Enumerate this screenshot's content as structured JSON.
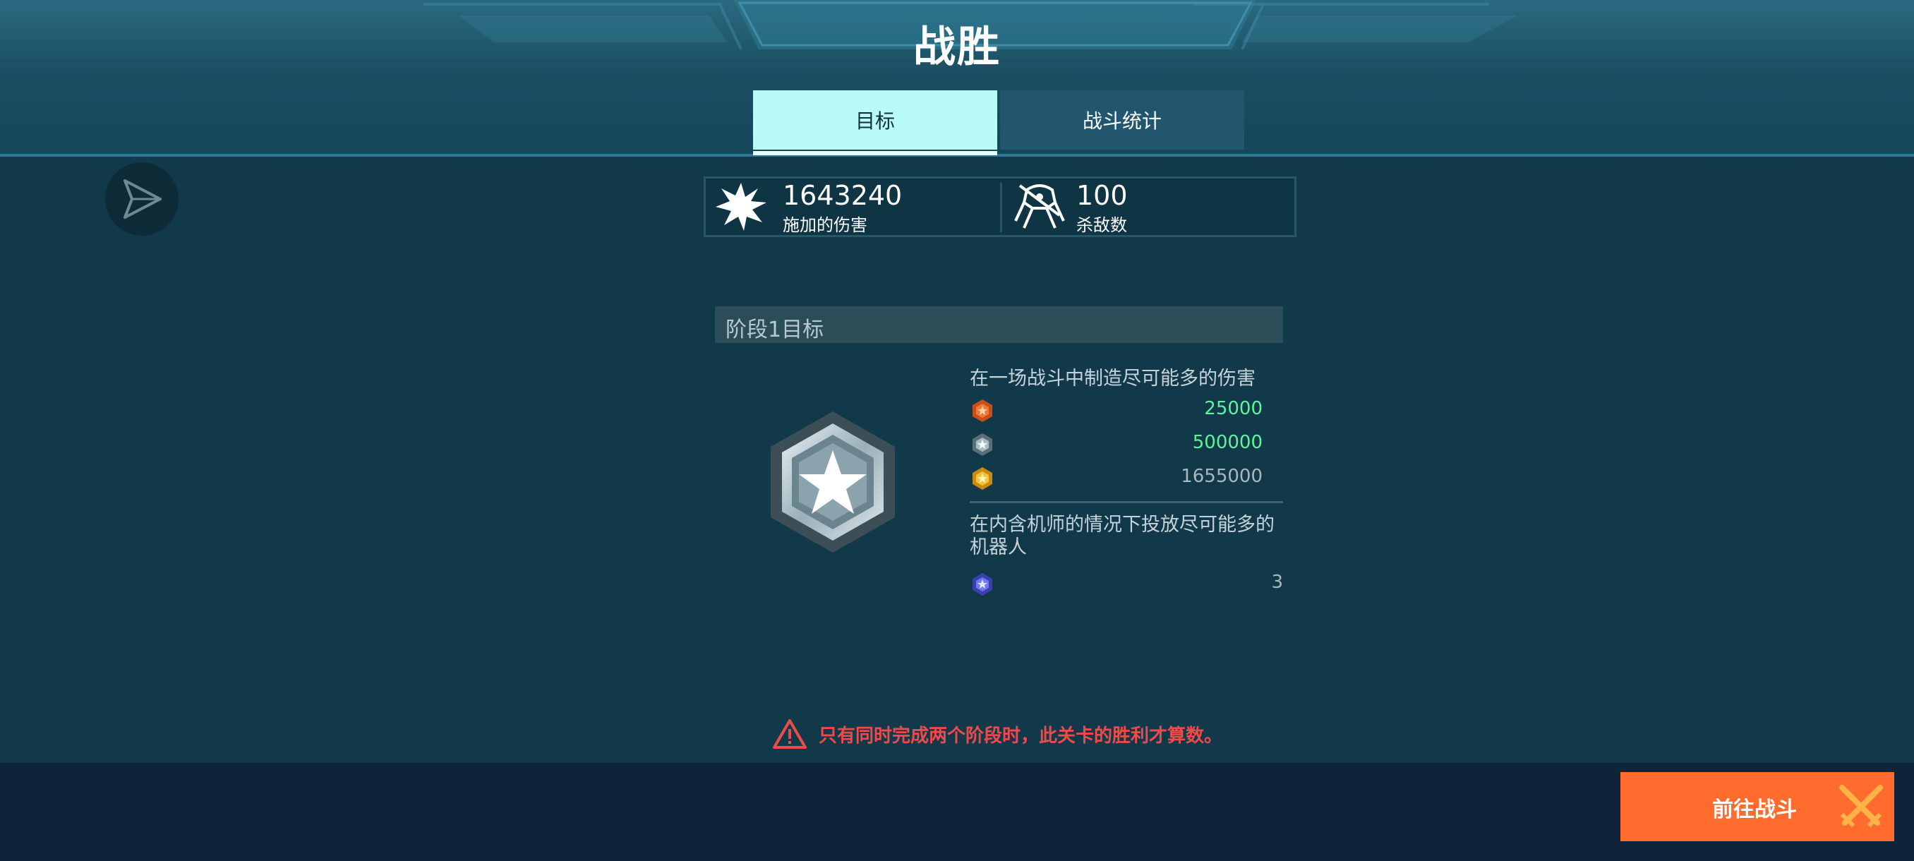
{
  "header": {
    "title": "战胜",
    "tabs": [
      {
        "label": "目标",
        "active": true
      },
      {
        "label": "战斗统计",
        "active": false
      }
    ]
  },
  "share": {
    "icon": "share-arrow-icon"
  },
  "stats": [
    {
      "icon": "burst-icon",
      "value": "1643240",
      "label": "施加的伤害"
    },
    {
      "icon": "robot-kill-icon",
      "value": "100",
      "label": "杀敌数"
    }
  ],
  "stage": {
    "title": "阶段1目标",
    "medal_icon": "silver-star-medal-icon",
    "objectives": [
      {
        "title": "在一场战斗中制造尽可能多的伤害",
        "rewards": [
          {
            "icon": "bronze-rank-icon",
            "value": "25000",
            "achieved": true
          },
          {
            "icon": "silver-rank-icon",
            "value": "500000",
            "achieved": true
          },
          {
            "icon": "gold-rank-icon",
            "value": "1655000",
            "achieved": false
          }
        ]
      },
      {
        "title": "在内含机师的情况下投放尽可能多的机器人",
        "rewards": [
          {
            "icon": "blue-rank-icon",
            "value": "3",
            "achieved": false
          }
        ]
      }
    ]
  },
  "warning": {
    "icon": "warning-triangle-icon",
    "text": "只有同时完成两个阶段时，此关卡的胜利才算数。"
  },
  "footer": {
    "go_button_label": "前往战斗",
    "go_button_icon": "crossed-swords-icon"
  },
  "colors": {
    "accent_tab": "#b9fbf7",
    "achieved": "#5ef29b",
    "warning": "#ef4a4a",
    "go_button": "#ff6c2d"
  }
}
